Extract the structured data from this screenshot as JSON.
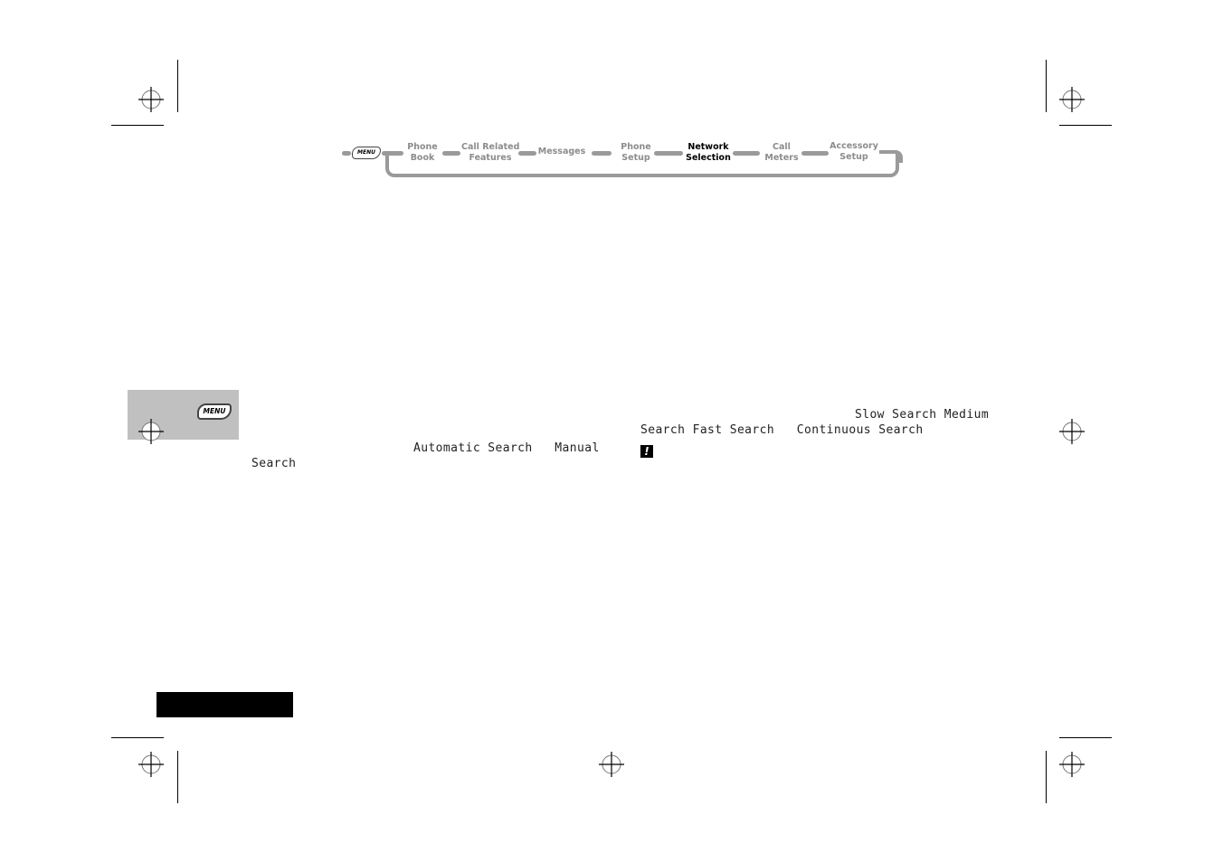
{
  "nav": {
    "menu_key_label": "MENU",
    "items": [
      {
        "line1": "Phone",
        "line2": "Book",
        "active": false
      },
      {
        "line1": "Call Related",
        "line2": "Features",
        "active": false
      },
      {
        "line1": "Messages",
        "line2": "",
        "active": false
      },
      {
        "line1": "Phone",
        "line2": "Setup",
        "active": false
      },
      {
        "line1": "Network",
        "line2": "Selection",
        "active": true
      },
      {
        "line1": "Call",
        "line2": "Meters",
        "active": false
      },
      {
        "line1": "Accessory",
        "line2": "Setup",
        "active": false
      }
    ],
    "colors": {
      "inactive": "#8c8c8c",
      "active": "#000000",
      "track": "#9a9a9a"
    }
  },
  "side_tab": {
    "menu_key_label": "MENU",
    "background": "#c0c0c0"
  },
  "left_column": {
    "line1": "Automatic Search   Manual",
    "line2": "Search"
  },
  "right_column": {
    "line1": "Slow Search Medium",
    "line2": "Search Fast Search   Continuous Search",
    "warning_icon_glyph": "!"
  }
}
